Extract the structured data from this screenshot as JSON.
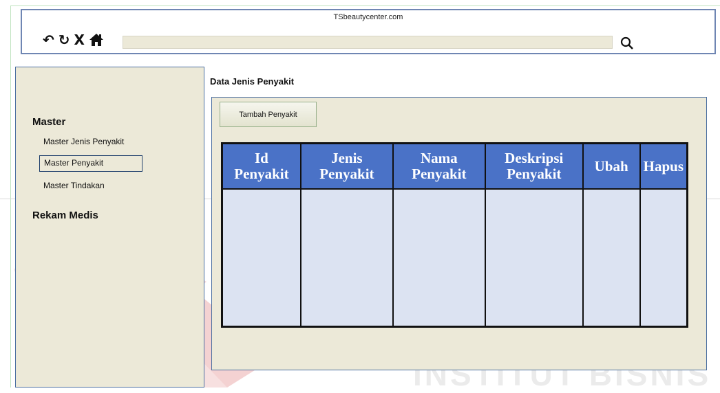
{
  "browser": {
    "url": "TSbeautycenter.com",
    "nav": {
      "back_glyph": "↶",
      "refresh_glyph": "↻",
      "stop_glyph": "X"
    }
  },
  "sidebar": {
    "sections": [
      {
        "title": "Master",
        "items": [
          "Master Jenis Penyakit",
          "Master Penyakit",
          "Master Tindakan"
        ]
      },
      {
        "title": "Rekam Medis"
      }
    ],
    "active_item": "Master Penyakit"
  },
  "main": {
    "title": "Data Jenis Penyakit",
    "add_button": "Tambah Penyakit",
    "table": {
      "headers": [
        [
          "Id",
          "Penyakit"
        ],
        [
          "Jenis",
          "Penyakit"
        ],
        [
          "Nama",
          "Penyakit"
        ],
        [
          "Deskripsi",
          "Penyakit"
        ],
        [
          "Ubah"
        ],
        [
          "Hapus"
        ]
      ]
    }
  },
  "watermark": {
    "text": "INSTITUT BISNIS"
  },
  "colors": {
    "header_bg": "#4a72c7",
    "cell_bg": "#dce3f2",
    "panel_bg": "#ece9d8"
  }
}
